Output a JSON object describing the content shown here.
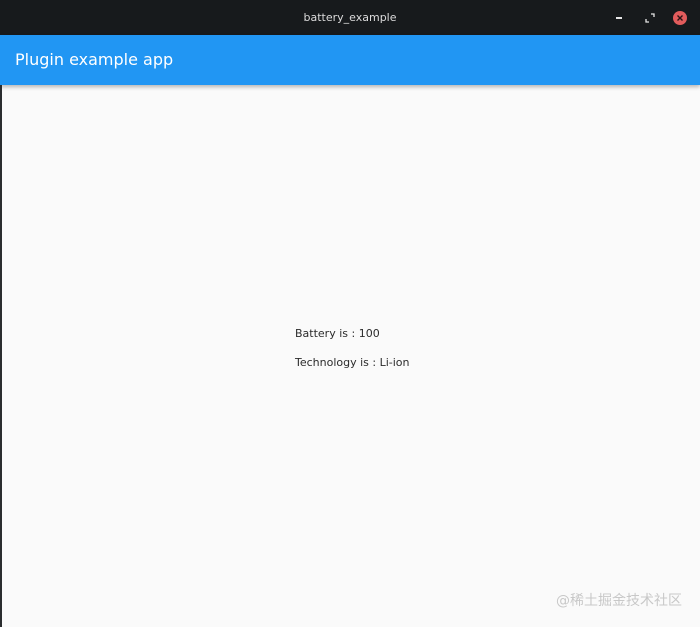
{
  "window": {
    "title": "battery_example",
    "controls": {
      "minimize_icon": "minimize-icon",
      "maximize_icon": "restore-icon",
      "close_icon": "close-icon"
    }
  },
  "appbar": {
    "title": "Plugin example app",
    "color": "#2196f3"
  },
  "content": {
    "battery_text": "Battery is : 100",
    "technology_text": "Technology is : Li-ion"
  },
  "watermark": {
    "text": "@稀土掘金技术社区"
  }
}
